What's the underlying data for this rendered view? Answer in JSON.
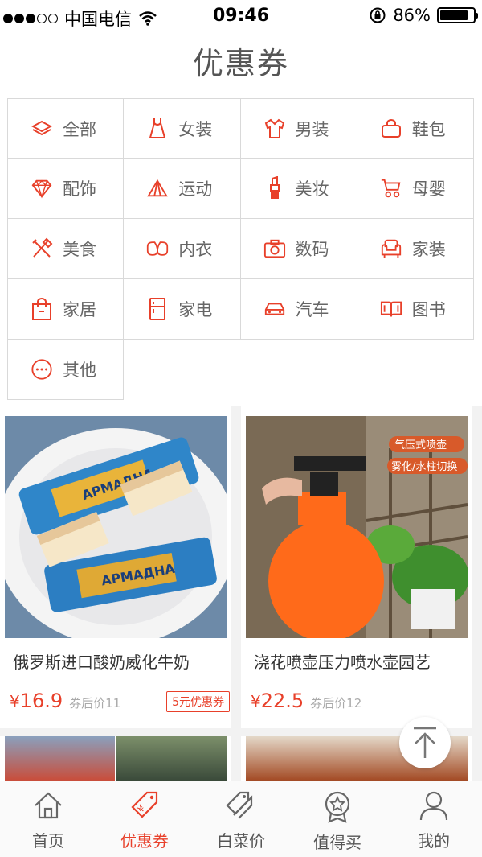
{
  "status_bar": {
    "carrier": "中国电信",
    "time": "09:46",
    "battery": "86%",
    "battery_level": 0.86
  },
  "header": {
    "title": "优惠券"
  },
  "categories": [
    {
      "label": "全部",
      "icon": "layers-icon"
    },
    {
      "label": "女装",
      "icon": "dress-icon"
    },
    {
      "label": "男装",
      "icon": "shirt-icon"
    },
    {
      "label": "鞋包",
      "icon": "bag-icon"
    },
    {
      "label": "配饰",
      "icon": "diamond-icon"
    },
    {
      "label": "运动",
      "icon": "tent-icon"
    },
    {
      "label": "美妆",
      "icon": "lipstick-icon"
    },
    {
      "label": "母婴",
      "icon": "stroller-icon"
    },
    {
      "label": "美食",
      "icon": "utensils-icon"
    },
    {
      "label": "内衣",
      "icon": "bra-icon"
    },
    {
      "label": "数码",
      "icon": "camera-icon"
    },
    {
      "label": "家装",
      "icon": "armchair-icon"
    },
    {
      "label": "家居",
      "icon": "shopping-bag-icon"
    },
    {
      "label": "家电",
      "icon": "fridge-icon"
    },
    {
      "label": "汽车",
      "icon": "car-icon"
    },
    {
      "label": "图书",
      "icon": "book-icon"
    },
    {
      "label": "其他",
      "icon": "more-icon"
    }
  ],
  "products": [
    {
      "name": "俄罗斯进口酸奶威化牛奶",
      "currency": "¥",
      "price": "16.9",
      "after_label": "券后价11",
      "coupon": "5元优惠券",
      "image_labels": [
        "АРМАДНА",
        "АРМАДНА"
      ]
    },
    {
      "name": "浇花喷壶压力喷水壶园艺",
      "currency": "¥",
      "price": "22.5",
      "after_label": "券后价12",
      "image_labels": [
        "气压式喷壶",
        "雾化/水柱切换"
      ]
    }
  ],
  "tabbar": [
    {
      "label": "首页",
      "icon": "home-icon",
      "active": false
    },
    {
      "label": "优惠券",
      "icon": "coupon-tag-icon",
      "active": true
    },
    {
      "label": "白菜价",
      "icon": "tags-icon",
      "active": false
    },
    {
      "label": "值得买",
      "icon": "badge-star-icon",
      "active": false
    },
    {
      "label": "我的",
      "icon": "user-icon",
      "active": false
    }
  ],
  "colors": {
    "accent": "#e8402a",
    "text_gray": "#666666",
    "border": "#d9d9d9"
  }
}
